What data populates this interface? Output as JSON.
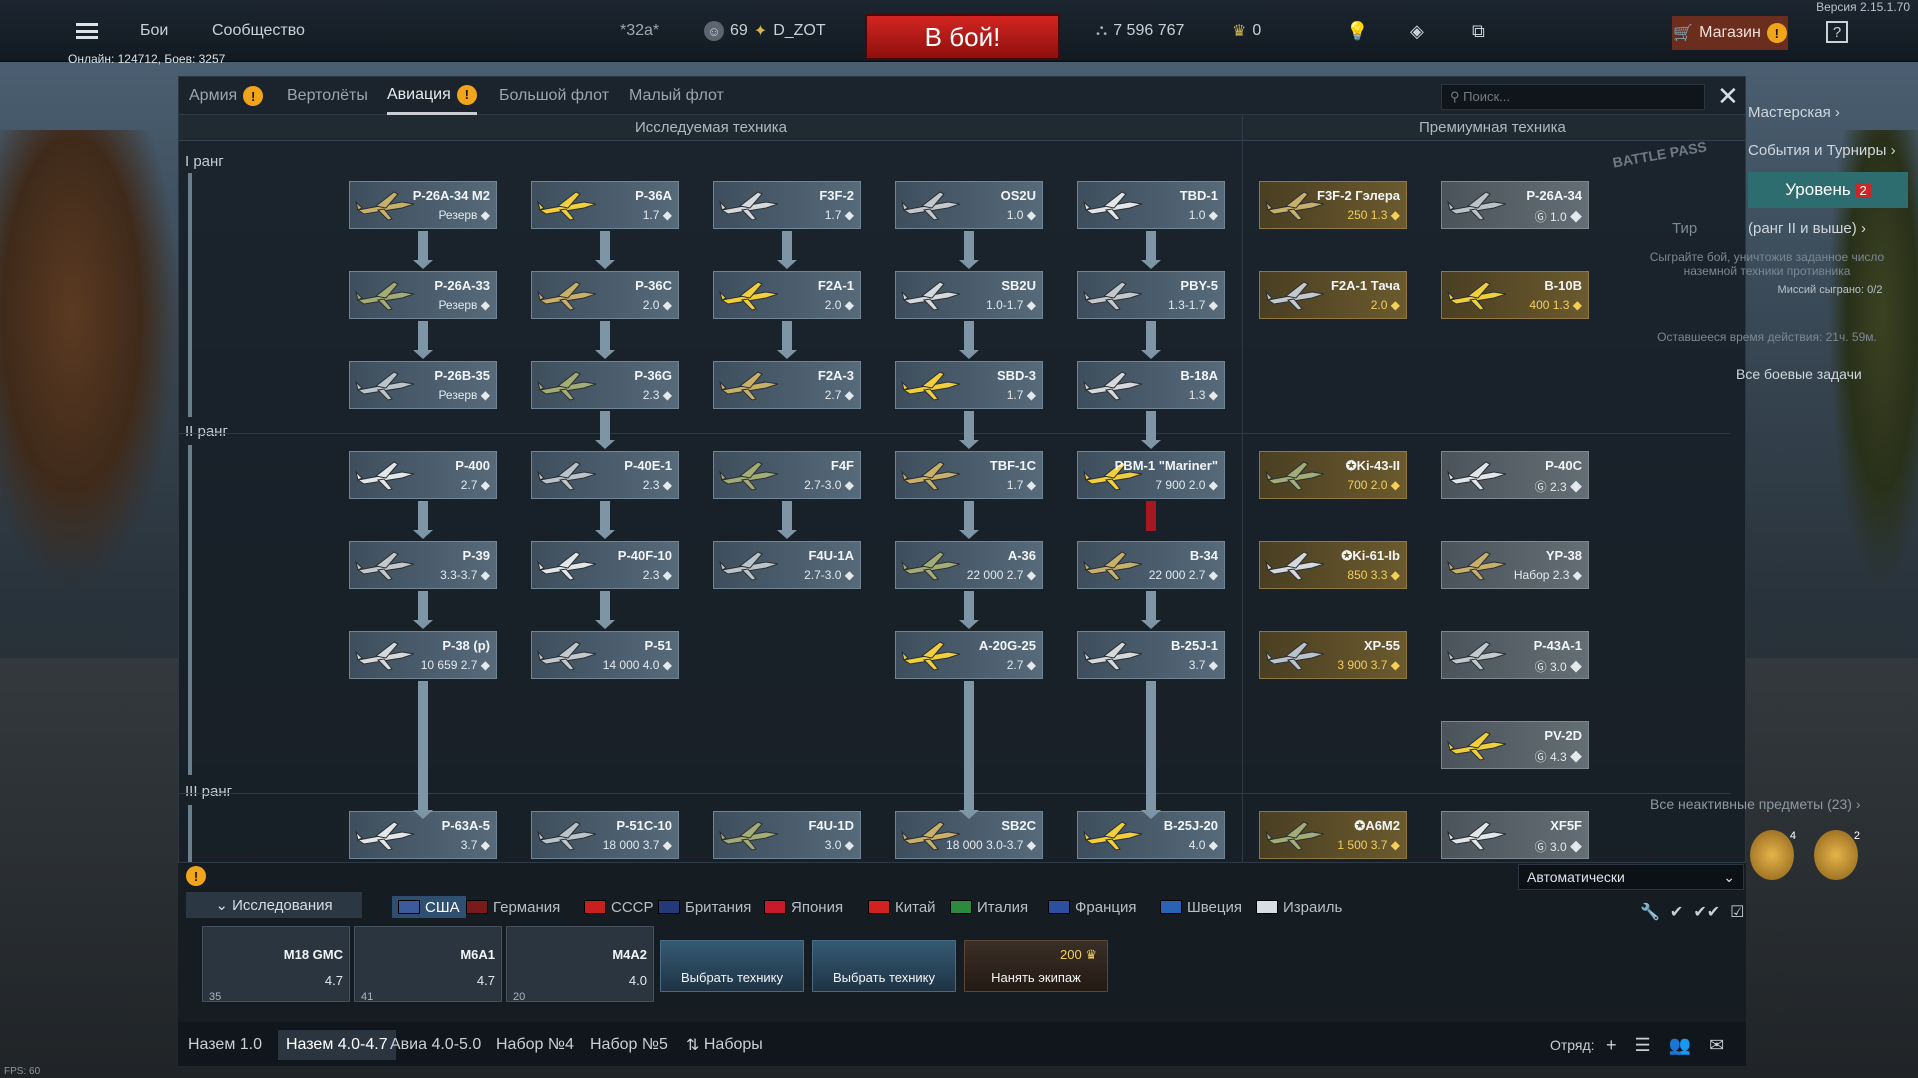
{
  "version": "Версия 2.15.1.70",
  "online": "Онлайн: 124712, Боев: 3257",
  "fps": "FPS: 60",
  "topbar": {
    "battles": "Бои",
    "community": "Сообщество",
    "squad_tag": "*32a*",
    "level": "69",
    "nickname": "D_ZOT",
    "battle_button": "В бой!",
    "silver": "7 596 767",
    "gold": "0",
    "shop": "Магазин"
  },
  "tabs": [
    {
      "label": "Армия"
    },
    {
      "label": "Вертолёты"
    },
    {
      "label": "Авиация"
    },
    {
      "label": "Большой флот"
    },
    {
      "label": "Малый флот"
    }
  ],
  "search_placeholder": "Поиск...",
  "sections": {
    "researched": "Исследуемая техника",
    "premium": "Премиумная техника"
  },
  "ranks": [
    "I ранг",
    "II ранг",
    "III ранг"
  ],
  "tree": [
    {
      "name": "P-26A-34 M2",
      "br": "Резерв ◆"
    },
    {
      "name": "P-36A",
      "br": "1.7 ◆"
    },
    {
      "name": "F3F-2",
      "br": "1.7 ◆"
    },
    {
      "name": "OS2U",
      "br": "1.0 ◆"
    },
    {
      "name": "TBD-1",
      "br": "1.0 ◆"
    },
    {
      "name": "P-26A-33",
      "br": "Резерв ◆"
    },
    {
      "name": "P-36C",
      "br": "2.0 ◆"
    },
    {
      "name": "F2A-1",
      "br": "2.0 ◆"
    },
    {
      "name": "SB2U",
      "br": "1.0-1.7 ◆"
    },
    {
      "name": "PBY-5",
      "br": "1.3-1.7 ◆"
    },
    {
      "name": "P-26B-35",
      "br": "Резерв ◆"
    },
    {
      "name": "P-36G",
      "br": "2.3 ◆"
    },
    {
      "name": "F2A-3",
      "br": "2.7 ◆"
    },
    {
      "name": "SBD-3",
      "br": "1.7 ◆"
    },
    {
      "name": "B-18A",
      "br": "1.3 ◆"
    },
    {
      "name": "P-400",
      "br": "2.7 ◆"
    },
    {
      "name": "P-40E-1",
      "br": "2.3 ◆"
    },
    {
      "name": "F4F",
      "br": "2.7-3.0 ◆"
    },
    {
      "name": "TBF-1C",
      "br": "1.7 ◆"
    },
    {
      "name": "PBM-1 \"Mariner\"",
      "br": "7 900 2.0 ◆"
    },
    {
      "name": "P-39",
      "br": "3.3-3.7 ◆"
    },
    {
      "name": "P-40F-10",
      "br": "2.3 ◆"
    },
    {
      "name": "F4U-1A",
      "br": "2.7-3.0 ◆"
    },
    {
      "name": "A-36",
      "br": "22 000 2.7 ◆"
    },
    {
      "name": "B-34",
      "br": "22 000 2.7 ◆"
    },
    {
      "name": "P-38 (p)",
      "br": "10 659 2.7 ◆"
    },
    {
      "name": "P-51",
      "br": "14 000 4.0 ◆"
    },
    {
      "name": "A-20G-25",
      "br": "2.7 ◆"
    },
    {
      "name": "B-25J-1",
      "br": "3.7 ◆"
    },
    {
      "name": "P-63A-5",
      "br": "3.7 ◆"
    },
    {
      "name": "P-51C-10",
      "br": "18 000 3.7 ◆"
    },
    {
      "name": "F4U-1D",
      "br": "3.0 ◆"
    },
    {
      "name": "SB2C",
      "br": "18 000 3.0-3.7 ◆"
    },
    {
      "name": "B-25J-20",
      "br": "4.0 ◆"
    }
  ],
  "premium": [
    {
      "name": "F3F-2 Гэлера",
      "br": "250 1.3 ◆"
    },
    {
      "name": "P-26A-34",
      "br": "Ⓖ 1.0 ◆"
    },
    {
      "name": "F2A-1 Тача",
      "br": "2.0 ◆"
    },
    {
      "name": "B-10B",
      "br": "400 1.3 ◆"
    },
    {
      "name": "✪Ki-43-II",
      "br": "700 2.0 ◆"
    },
    {
      "name": "P-40C",
      "br": "Ⓖ 2.3 ◆"
    },
    {
      "name": "✪Ki-61-Ib",
      "br": "850 3.3 ◆"
    },
    {
      "name": "YP-38",
      "br": "Набор 2.3 ◆"
    },
    {
      "name": "XP-55",
      "br": "3 900 3.7 ◆"
    },
    {
      "name": "P-43A-1",
      "br": "Ⓖ 3.0 ◆"
    },
    {
      "name": "PV-2D",
      "br": "Ⓖ 4.3 ◆"
    },
    {
      "name": "✪A6M2",
      "br": "1 500 3.7 ◆"
    },
    {
      "name": "XF5F",
      "br": "Ⓖ 3.0 ◆"
    }
  ],
  "right_panel": {
    "workshop": "Мастерская",
    "events": "События и Турниры",
    "battle_pass": "BATTLE PASS",
    "level_label": "Уровень",
    "level_badge": "2",
    "tier": "Тир",
    "rank_req": "(ранг II и выше)",
    "task": "Сыграйте бой, уничтожив заданное число наземной техники противника",
    "task_progress": "Миссий сыграно: 0/2",
    "remaining": "Оставшееся время действия: 21ч. 59м.",
    "all_tasks": "Все боевые задачи",
    "inactive": "Все неактивные предметы (23)",
    "medal1_count": "4",
    "medal2_count": "2"
  },
  "auto_select": "Автоматически",
  "research_tab": "Исследования",
  "nations": [
    "США",
    "Германия",
    "СССР",
    "Британия",
    "Япония",
    "Китай",
    "Италия",
    "Франция",
    "Швеция",
    "Израиль"
  ],
  "crew": [
    {
      "name": "M18 GMC",
      "br": "4.7",
      "pts": "35"
    },
    {
      "name": "M6A1",
      "br": "4.7",
      "pts": "41"
    },
    {
      "name": "M4A2",
      "br": "4.0",
      "pts": "20"
    }
  ],
  "crew_actions": {
    "choose": "Выбрать технику",
    "choose2": "Выбрать технику",
    "hire": "Нанять экипаж",
    "hire_cost": "200"
  },
  "presets": [
    "Назем 1.0",
    "Назем 4.0-4.7",
    "Авиа 4.0-5.0",
    "Набор №4",
    "Набор №5",
    "Наборы"
  ],
  "squad_label": "Отряд:"
}
